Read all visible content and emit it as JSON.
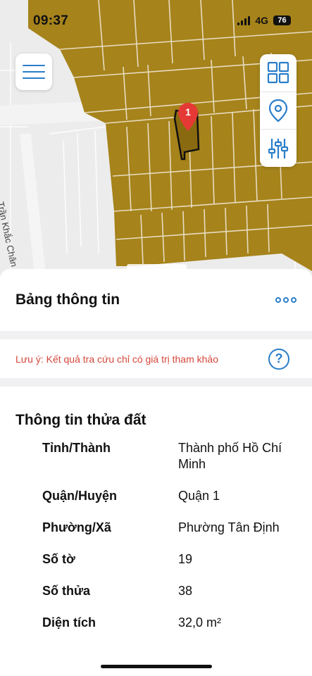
{
  "status_bar": {
    "time": "09:37",
    "network": "4G",
    "battery": "76"
  },
  "map": {
    "street_label": "Trần Khắc Chân",
    "marker_label": "1",
    "parcel_color": "#a6831b",
    "marker_color": "#e53935"
  },
  "map_controls": {
    "menu_icon": "hamburger-icon",
    "tools": [
      "grid-layers-icon",
      "location-pin-icon",
      "sliders-icon"
    ]
  },
  "panel": {
    "title": "Bảng thông tin",
    "more_icon": "more-dots-icon",
    "note": "Lưu ý: Kết quả tra cứu chỉ có giá trị tham khảo",
    "help_label": "?",
    "section_title": "Thông tin thửa đất",
    "rows": [
      {
        "label": "Tỉnh/Thành",
        "value": "Thành phố Hồ Chí Minh"
      },
      {
        "label": "Quận/Huyện",
        "value": "Quận 1"
      },
      {
        "label": "Phường/Xã",
        "value": "Phường Tân Định"
      },
      {
        "label": "Số tờ",
        "value": "19"
      },
      {
        "label": "Số thửa",
        "value": "38"
      },
      {
        "label": "Diện tích",
        "value": "32,0 m²"
      }
    ]
  },
  "colors": {
    "accent": "#2a7ec9",
    "warning": "#d4473a"
  }
}
